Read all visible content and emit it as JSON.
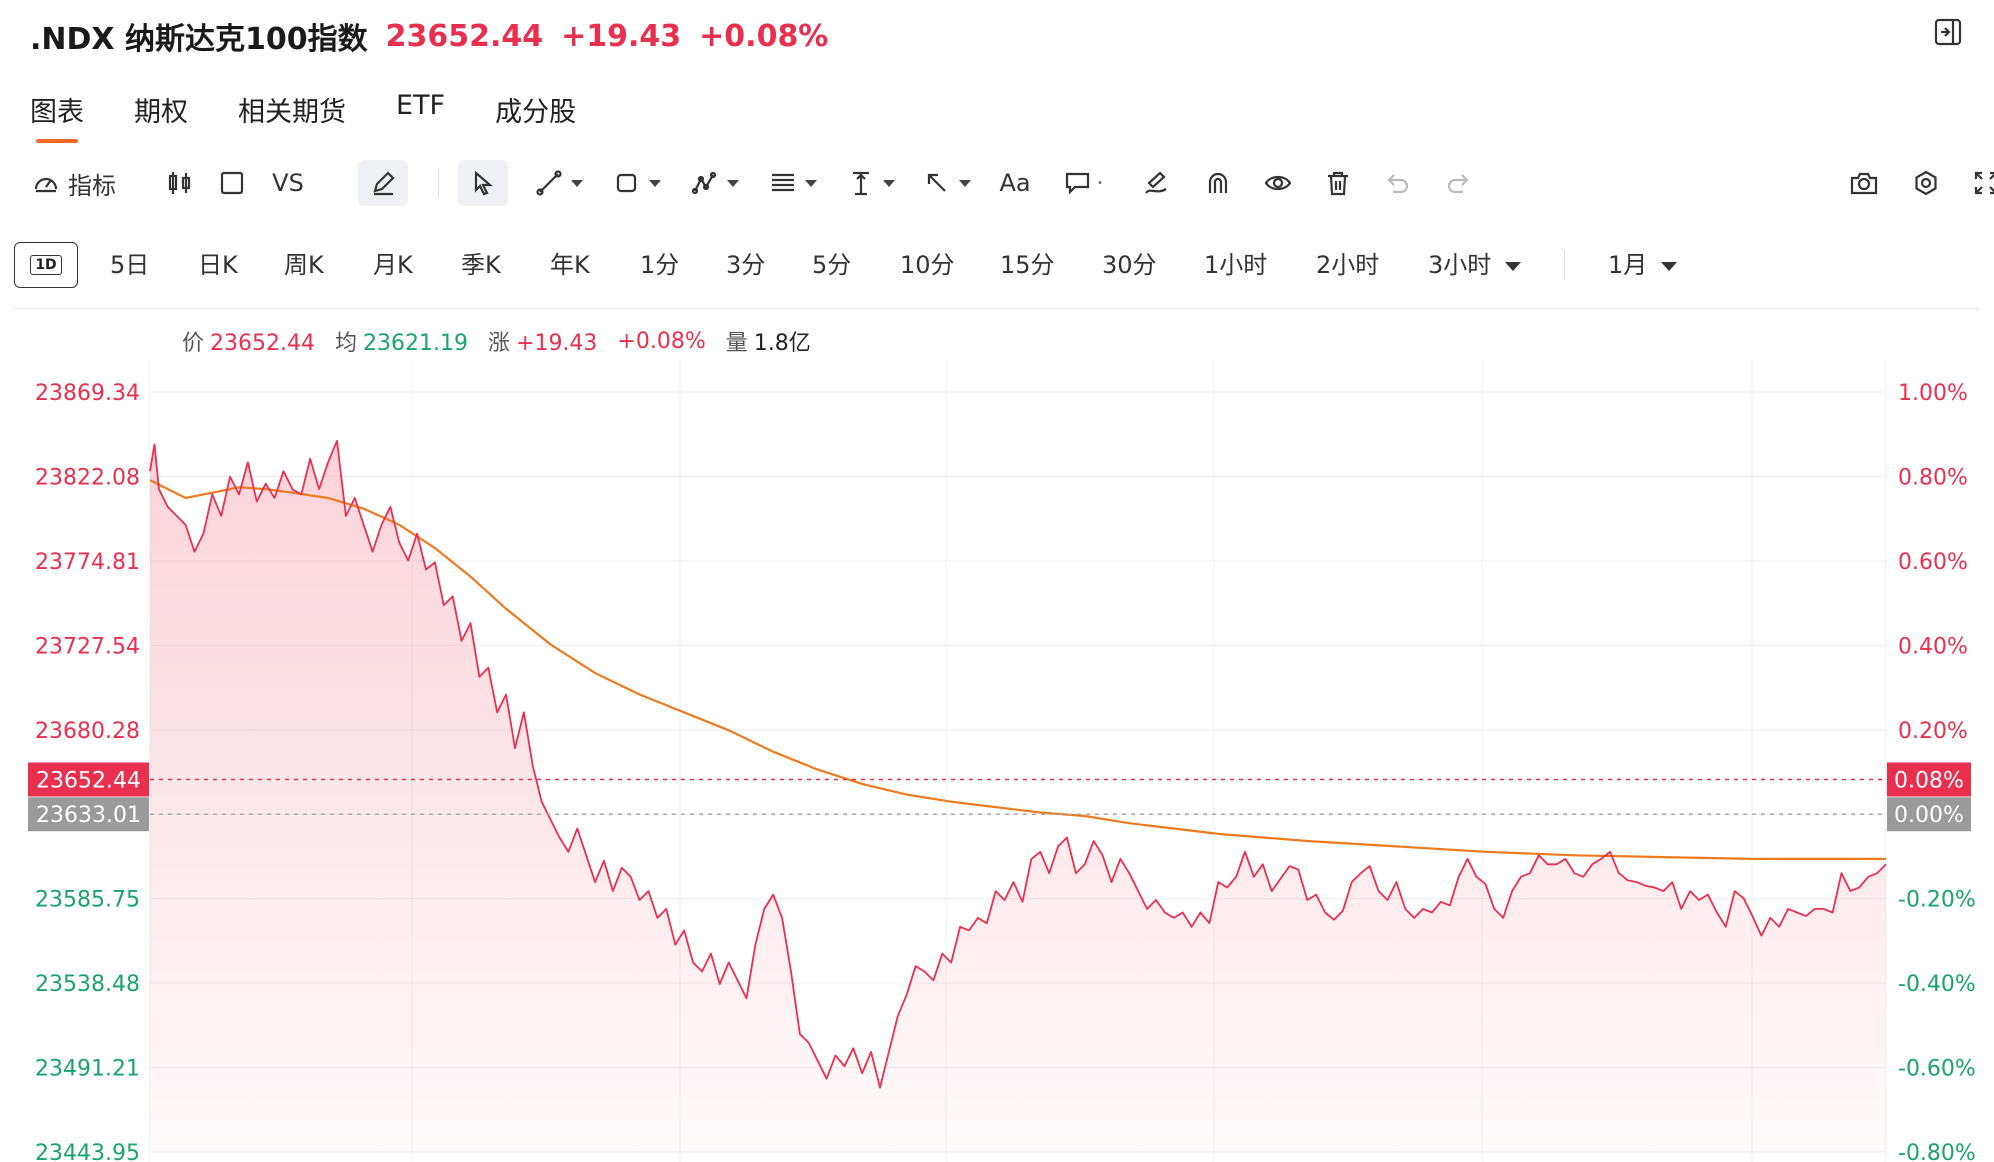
{
  "header": {
    "symbol_name": ".NDX 纳斯达克100指数",
    "price": "23652.44",
    "change": "+19.43",
    "change_pct": "+0.08%"
  },
  "tabs": [
    "图表",
    "期权",
    "相关期货",
    "ETF",
    "成分股"
  ],
  "toolbar": {
    "indicators_label": "指标",
    "vs_label": "VS",
    "text_tool_label": "Aa"
  },
  "periods": {
    "intraday_label": "1D",
    "items": [
      "5日",
      "日K",
      "周K",
      "月K",
      "季K",
      "年K",
      "1分",
      "3分",
      "5分",
      "10分",
      "15分",
      "30分",
      "1小时",
      "2小时",
      "3小时"
    ],
    "month_selector": "1月"
  },
  "info": {
    "price_label": "价",
    "price": "23652.44",
    "avg_label": "均",
    "avg": "23621.19",
    "chg_label": "涨",
    "chg": "+19.43",
    "chg_pct": "+0.08%",
    "vol_label": "量",
    "vol": "1.8亿"
  },
  "colors": {
    "up": "#e8304e",
    "down": "#1aa36f",
    "avg_line": "#ee7a1e",
    "accent": "#f26b23"
  },
  "chart_data": {
    "type": "area",
    "y_ticks_left": [
      "23869.34",
      "23822.08",
      "23774.81",
      "23727.54",
      "23680.28",
      "23633.01",
      "23585.75",
      "23538.48",
      "23491.21",
      "23443.95"
    ],
    "y_ticks_right": [
      "1.00%",
      "0.80%",
      "0.60%",
      "0.40%",
      "0.20%",
      "0.00%",
      "-0.20%",
      "-0.40%",
      "-0.60%",
      "-0.80%"
    ],
    "ylim": [
      23443.95,
      23869.34
    ],
    "prev_close": 23633.01,
    "current_price": 23652.44,
    "current_label": "23652.44",
    "current_pct_label": "0.08%",
    "prev_close_label": "23633.01",
    "prev_close_pct_label": "0.00%",
    "x_range": [
      0,
      390
    ],
    "series": [
      {
        "values": [
          [
            0,
            23825
          ],
          [
            1,
            23840
          ],
          [
            2,
            23815
          ],
          [
            4,
            23805
          ],
          [
            6,
            23800
          ],
          [
            8,
            23795
          ],
          [
            10,
            23780
          ],
          [
            12,
            23790
          ],
          [
            14,
            23812
          ],
          [
            16,
            23800
          ],
          [
            18,
            23822
          ],
          [
            20,
            23812
          ],
          [
            22,
            23830
          ],
          [
            24,
            23808
          ],
          [
            26,
            23818
          ],
          [
            28,
            23810
          ],
          [
            30,
            23825
          ],
          [
            32,
            23815
          ],
          [
            34,
            23812
          ],
          [
            36,
            23832
          ],
          [
            38,
            23815
          ],
          [
            40,
            23830
          ],
          [
            42,
            23842
          ],
          [
            44,
            23800
          ],
          [
            46,
            23810
          ],
          [
            48,
            23795
          ],
          [
            50,
            23780
          ],
          [
            52,
            23795
          ],
          [
            54,
            23805
          ],
          [
            56,
            23785
          ],
          [
            58,
            23775
          ],
          [
            60,
            23790
          ],
          [
            62,
            23770
          ],
          [
            64,
            23774
          ],
          [
            66,
            23750
          ],
          [
            68,
            23755
          ],
          [
            70,
            23730
          ],
          [
            72,
            23740
          ],
          [
            74,
            23710
          ],
          [
            76,
            23715
          ],
          [
            78,
            23690
          ],
          [
            80,
            23700
          ],
          [
            82,
            23670
          ],
          [
            84,
            23690
          ],
          [
            86,
            23660
          ],
          [
            88,
            23640
          ],
          [
            90,
            23630
          ],
          [
            92,
            23620
          ],
          [
            94,
            23612
          ],
          [
            96,
            23625
          ],
          [
            98,
            23610
          ],
          [
            100,
            23595
          ],
          [
            102,
            23607
          ],
          [
            104,
            23590
          ],
          [
            106,
            23603
          ],
          [
            108,
            23598
          ],
          [
            110,
            23585
          ],
          [
            112,
            23590
          ],
          [
            114,
            23575
          ],
          [
            116,
            23580
          ],
          [
            118,
            23560
          ],
          [
            120,
            23568
          ],
          [
            122,
            23550
          ],
          [
            124,
            23545
          ],
          [
            126,
            23555
          ],
          [
            128,
            23538
          ],
          [
            130,
            23550
          ],
          [
            132,
            23540
          ],
          [
            134,
            23530
          ],
          [
            136,
            23560
          ],
          [
            138,
            23580
          ],
          [
            140,
            23588
          ],
          [
            142,
            23575
          ],
          [
            144,
            23545
          ],
          [
            146,
            23510
          ],
          [
            148,
            23505
          ],
          [
            150,
            23495
          ],
          [
            152,
            23485
          ],
          [
            154,
            23498
          ],
          [
            156,
            23492
          ],
          [
            158,
            23502
          ],
          [
            160,
            23488
          ],
          [
            162,
            23500
          ],
          [
            164,
            23480
          ],
          [
            166,
            23500
          ],
          [
            168,
            23520
          ],
          [
            170,
            23532
          ],
          [
            172,
            23548
          ],
          [
            174,
            23545
          ],
          [
            176,
            23540
          ],
          [
            178,
            23555
          ],
          [
            180,
            23550
          ],
          [
            182,
            23570
          ],
          [
            184,
            23568
          ],
          [
            186,
            23575
          ],
          [
            188,
            23572
          ],
          [
            190,
            23590
          ],
          [
            192,
            23585
          ],
          [
            194,
            23595
          ],
          [
            196,
            23584
          ],
          [
            198,
            23608
          ],
          [
            200,
            23612
          ],
          [
            202,
            23600
          ],
          [
            204,
            23615
          ],
          [
            206,
            23620
          ],
          [
            208,
            23600
          ],
          [
            210,
            23605
          ],
          [
            212,
            23618
          ],
          [
            214,
            23610
          ],
          [
            216,
            23595
          ],
          [
            218,
            23608
          ],
          [
            220,
            23600
          ],
          [
            222,
            23590
          ],
          [
            224,
            23580
          ],
          [
            226,
            23585
          ],
          [
            228,
            23578
          ],
          [
            230,
            23575
          ],
          [
            232,
            23578
          ],
          [
            234,
            23570
          ],
          [
            236,
            23578
          ],
          [
            238,
            23572
          ],
          [
            240,
            23595
          ],
          [
            242,
            23592
          ],
          [
            244,
            23598
          ],
          [
            246,
            23612
          ],
          [
            248,
            23598
          ],
          [
            250,
            23605
          ],
          [
            252,
            23590
          ],
          [
            254,
            23597
          ],
          [
            256,
            23604
          ],
          [
            258,
            23602
          ],
          [
            260,
            23585
          ],
          [
            262,
            23588
          ],
          [
            264,
            23578
          ],
          [
            266,
            23574
          ],
          [
            268,
            23579
          ],
          [
            270,
            23595
          ],
          [
            272,
            23600
          ],
          [
            274,
            23604
          ],
          [
            276,
            23590
          ],
          [
            278,
            23585
          ],
          [
            280,
            23595
          ],
          [
            282,
            23580
          ],
          [
            284,
            23575
          ],
          [
            286,
            23580
          ],
          [
            288,
            23578
          ],
          [
            290,
            23584
          ],
          [
            292,
            23582
          ],
          [
            294,
            23598
          ],
          [
            296,
            23608
          ],
          [
            298,
            23598
          ],
          [
            300,
            23594
          ],
          [
            302,
            23580
          ],
          [
            304,
            23575
          ],
          [
            306,
            23590
          ],
          [
            308,
            23598
          ],
          [
            310,
            23600
          ],
          [
            312,
            23610
          ],
          [
            314,
            23605
          ],
          [
            316,
            23605
          ],
          [
            318,
            23608
          ],
          [
            320,
            23600
          ],
          [
            322,
            23598
          ],
          [
            324,
            23605
          ],
          [
            326,
            23608
          ],
          [
            328,
            23612
          ],
          [
            330,
            23600
          ],
          [
            332,
            23596
          ],
          [
            334,
            23595
          ],
          [
            336,
            23593
          ],
          [
            338,
            23592
          ],
          [
            340,
            23590
          ],
          [
            342,
            23595
          ],
          [
            344,
            23580
          ],
          [
            346,
            23590
          ],
          [
            348,
            23585
          ],
          [
            350,
            23588
          ],
          [
            352,
            23578
          ],
          [
            354,
            23570
          ],
          [
            356,
            23590
          ],
          [
            358,
            23586
          ],
          [
            360,
            23576
          ],
          [
            362,
            23565
          ],
          [
            364,
            23575
          ],
          [
            366,
            23570
          ],
          [
            368,
            23580
          ],
          [
            370,
            23578
          ],
          [
            372,
            23576
          ],
          [
            374,
            23580
          ],
          [
            376,
            23580
          ],
          [
            378,
            23578
          ],
          [
            380,
            23600
          ],
          [
            382,
            23590
          ],
          [
            384,
            23592
          ],
          [
            386,
            23598
          ],
          [
            388,
            23600
          ],
          [
            390,
            23605
          ]
        ]
      },
      {
        "name": "均",
        "values": [
          [
            0,
            23820
          ],
          [
            8,
            23810
          ],
          [
            14,
            23813
          ],
          [
            20,
            23816
          ],
          [
            26,
            23815
          ],
          [
            32,
            23813
          ],
          [
            40,
            23810
          ],
          [
            48,
            23804
          ],
          [
            56,
            23795
          ],
          [
            64,
            23782
          ],
          [
            72,
            23766
          ],
          [
            80,
            23748
          ],
          [
            90,
            23728
          ],
          [
            100,
            23712
          ],
          [
            110,
            23700
          ],
          [
            120,
            23690
          ],
          [
            130,
            23680
          ],
          [
            140,
            23668
          ],
          [
            150,
            23658
          ],
          [
            160,
            23650
          ],
          [
            170,
            23644
          ],
          [
            180,
            23640
          ],
          [
            190,
            23637
          ],
          [
            200,
            23634
          ],
          [
            210,
            23632
          ],
          [
            220,
            23628
          ],
          [
            230,
            23625
          ],
          [
            240,
            23622
          ],
          [
            260,
            23618
          ],
          [
            280,
            23615
          ],
          [
            300,
            23612
          ],
          [
            320,
            23610
          ],
          [
            340,
            23609
          ],
          [
            360,
            23608
          ],
          [
            380,
            23608
          ],
          [
            390,
            23608
          ]
        ]
      }
    ]
  }
}
